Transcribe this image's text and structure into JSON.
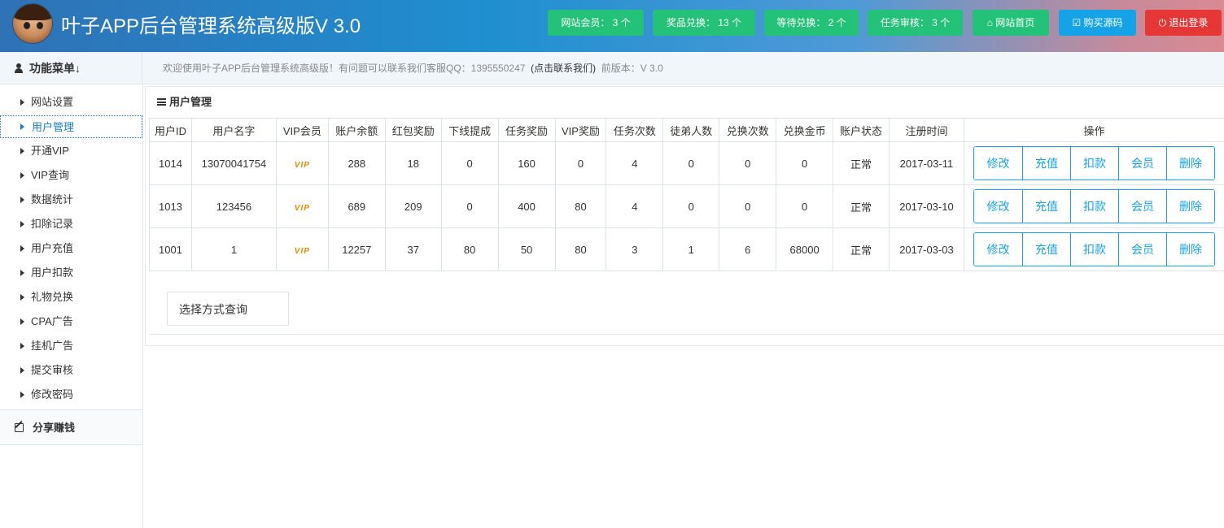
{
  "header": {
    "title": "叶子APP后台管理系统高级版V 3.0",
    "badges": [
      {
        "label": "网站会员： 3 个"
      },
      {
        "label": "奖品兑换： 13 个"
      },
      {
        "label": "等待兑换： 2 个"
      },
      {
        "label": "任务审核： 3 个"
      }
    ],
    "home_label": "网站首页",
    "buy_label": "购买源码",
    "logout_label": "退出登录",
    "colors": {
      "green": "#24c179",
      "blue": "#15a2e6",
      "red": "#e63737"
    }
  },
  "subbar": {
    "menu_title": "功能菜单↓",
    "welcome": "欢迎使用叶子APP后台管理系统高级版！有问题可以联系我们客服QQ：1395550247",
    "contact": "(点击联系我们)",
    "version": "前版本：V 3.0"
  },
  "sidebar": {
    "items": [
      {
        "label": "网站设置"
      },
      {
        "label": "用户管理"
      },
      {
        "label": "开通VIP"
      },
      {
        "label": "VIP查询"
      },
      {
        "label": "数据统计"
      },
      {
        "label": "扣除记录"
      },
      {
        "label": "用户充值"
      },
      {
        "label": "用户扣款"
      },
      {
        "label": "礼物兑换"
      },
      {
        "label": "CPA广告"
      },
      {
        "label": "挂机广告"
      },
      {
        "label": "提交审核"
      },
      {
        "label": "修改密码"
      }
    ],
    "active_index": 1,
    "share_label": "分享赚钱"
  },
  "main": {
    "panel_title": "用户管理",
    "columns": [
      "用户ID",
      "用户名字",
      "VIP会员",
      "账户余额",
      "红包奖励",
      "下线提成",
      "任务奖励",
      "VIP奖励",
      "任务次数",
      "徒弟人数",
      "兑换次数",
      "兑换金币",
      "账户状态",
      "注册时间",
      "操作"
    ],
    "rows": [
      {
        "id": "1014",
        "name": "13070041754",
        "vip": "VIP",
        "balance": "288",
        "redpack": "18",
        "commission": "0",
        "task_reward": "160",
        "vip_reward": "0",
        "task_count": "4",
        "apprentices": "0",
        "exchange_count": "0",
        "exchange_coins": "0",
        "status": "正常",
        "reg_time": "2017-03-11"
      },
      {
        "id": "1013",
        "name": "123456",
        "vip": "VIP",
        "balance": "689",
        "redpack": "209",
        "commission": "0",
        "task_reward": "400",
        "vip_reward": "80",
        "task_count": "4",
        "apprentices": "0",
        "exchange_count": "0",
        "exchange_coins": "0",
        "status": "正常",
        "reg_time": "2017-03-10"
      },
      {
        "id": "1001",
        "name": "1",
        "vip": "VIP",
        "balance": "12257",
        "redpack": "37",
        "commission": "80",
        "task_reward": "50",
        "vip_reward": "80",
        "task_count": "3",
        "apprentices": "1",
        "exchange_count": "6",
        "exchange_coins": "68000",
        "status": "正常",
        "reg_time": "2017-03-03"
      }
    ],
    "op_labels": [
      "修改",
      "充值",
      "扣款",
      "会员",
      "删除"
    ],
    "query_label": "选择方式查询"
  }
}
